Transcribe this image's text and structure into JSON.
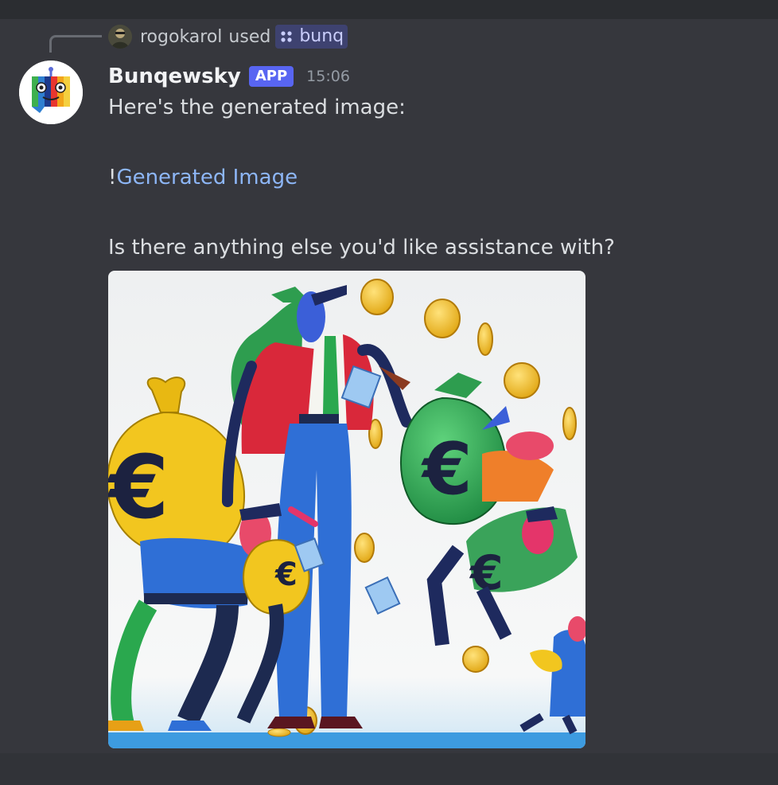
{
  "reply": {
    "username": "rogokarol",
    "used_text": "used",
    "command_name": "bunq"
  },
  "message": {
    "author": "Bunqewsky",
    "badge": "APP",
    "timestamp": "15:06",
    "line1": "Here's the generated image:",
    "bang": "!",
    "link_text": "Generated Image",
    "line3": "Is there anything else you'd like assistance with?"
  },
  "colors": {
    "accent": "#5865f2",
    "link": "#8db6f7",
    "background": "#36373d"
  }
}
